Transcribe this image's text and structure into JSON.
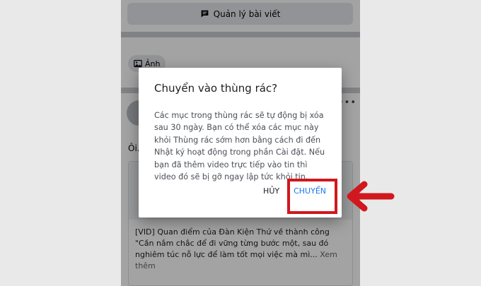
{
  "background": {
    "manage_posts_label": "Quản lý bài viết",
    "photo_chip_label": "Ảnh",
    "post_snippet": "Ôi...",
    "link_caption": "[VID] Quan điểm của Đàn Kiện Thứ về thành công \"Cần nắm chắc để đi vững từng bước một, sau đó nghiêm túc nỗ lực để làm tốt mọi việc mà mì...",
    "see_more": "Xem thêm"
  },
  "dialog": {
    "title": "Chuyển vào thùng rác?",
    "body": "Các mục trong thùng rác sẽ tự động bị xóa sau 30 ngày. Bạn có thể xóa các mục này khỏi Thùng rác sớm hơn bằng cách đi đến Nhật ký hoạt động trong phần Cài đặt. Nếu bạn đã thêm video trực tiếp vào tin thì video đó sẽ bị gỡ ngay lập tức khỏi tin.",
    "cancel_label": "HỦY",
    "confirm_label": "CHUYỂN"
  },
  "icons": {
    "manage": "message-square-icon",
    "photo": "image-icon",
    "more": "more-dots-icon",
    "callout": "arrow-left-icon"
  },
  "colors": {
    "accent": "#1877f2",
    "highlight": "#d0181e"
  }
}
